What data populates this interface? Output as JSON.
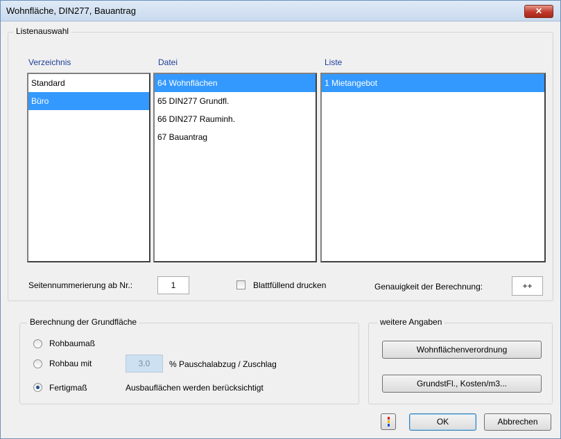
{
  "window": {
    "title": "Wohnfläche, DIN277, Bauantrag",
    "close_label": "✕"
  },
  "listenauswahl": {
    "legend": "Listenauswahl",
    "verzeichnis": {
      "header": "Verzeichnis",
      "items": [
        "Standard",
        "Büro"
      ]
    },
    "datei": {
      "header": "Datei",
      "items": [
        "64 Wohnflächen",
        "65 DIN277 Grundfl.",
        "66 DIN277 Rauminh.",
        "67 Bauantrag"
      ]
    },
    "liste": {
      "header": "Liste",
      "items": [
        "1 Mietangebot"
      ]
    },
    "seitennummerierung_label": "Seitennummerierung ab Nr.:",
    "seitennummerierung_value": "1",
    "blattfuellend_label": "Blattfüllend drucken",
    "blattfuellend_checked": false,
    "genauigkeit_label": "Genauigkeit der Berechnung:",
    "genauigkeit_value": "++"
  },
  "berechnung": {
    "legend": "Berechnung der Grundfläche",
    "options": [
      {
        "label": "Rohbaumaß",
        "checked": false
      },
      {
        "label": "Rohbau mit",
        "checked": false
      },
      {
        "label": "Fertigmaß",
        "checked": true
      }
    ],
    "pauschal_value": "3.0",
    "pauschal_label": "% Pauschalabzug / Zuschlag",
    "ausbau_label": "Ausbauflächen werden berücksichtigt"
  },
  "weitere": {
    "legend": "weitere Angaben",
    "wohnflaechen_button": "Wohnflächenverordnung",
    "grundst_button": "GrundstFl., Kosten/m3..."
  },
  "footer": {
    "ok_label": "OK",
    "cancel_label": "Abbrechen"
  },
  "colors": {
    "selection": "#3399ff",
    "header_text": "#1f3d99"
  }
}
